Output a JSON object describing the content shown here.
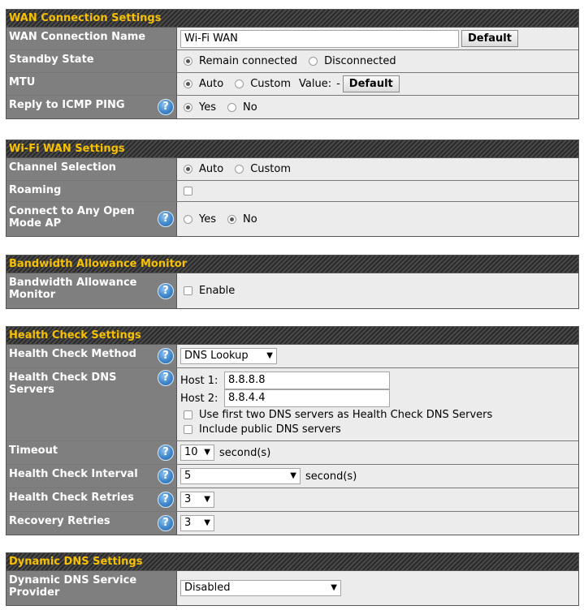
{
  "wan": {
    "title": "WAN Connection Settings",
    "name_label": "WAN Connection Name",
    "name_value": "Wi-Fi WAN",
    "default_btn": "Default",
    "standby_label": "Standby State",
    "standby_opt1": "Remain connected",
    "standby_opt2": "Disconnected",
    "mtu_label": "MTU",
    "mtu_opt1": "Auto",
    "mtu_opt2": "Custom",
    "mtu_value_label": "Value:",
    "mtu_value": "-",
    "mtu_default_btn": "Default",
    "icmp_label": "Reply to ICMP PING",
    "icmp_yes": "Yes",
    "icmp_no": "No"
  },
  "wifi": {
    "title": "Wi-Fi WAN Settings",
    "channel_label": "Channel Selection",
    "channel_opt1": "Auto",
    "channel_opt2": "Custom",
    "roaming_label": "Roaming",
    "open_label": "Connect to Any Open Mode AP",
    "open_yes": "Yes",
    "open_no": "No"
  },
  "bandwidth": {
    "title": "Bandwidth Allowance Monitor",
    "label": "Bandwidth Allowance Monitor",
    "enable": "Enable"
  },
  "health": {
    "title": "Health Check Settings",
    "method_label": "Health Check Method",
    "method_value": "DNS Lookup",
    "dns_label": "Health Check DNS Servers",
    "host1_label": "Host 1:",
    "host1_value": "8.8.8.8",
    "host2_label": "Host 2:",
    "host2_value": "8.8.4.4",
    "use_first": "Use first two DNS servers as Health Check DNS Servers",
    "include_public": "Include public DNS servers",
    "timeout_label": "Timeout",
    "timeout_value": "10",
    "seconds": "second(s)",
    "interval_label": "Health Check Interval",
    "interval_value": "5",
    "retries_label": "Health Check Retries",
    "retries_value": "3",
    "recovery_label": "Recovery Retries",
    "recovery_value": "3"
  },
  "ddns": {
    "title": "Dynamic DNS Settings",
    "provider_label": "Dynamic DNS Service Provider",
    "provider_value": "Disabled"
  },
  "icons": {
    "help": "?",
    "arrow": "▼",
    "help_icon_name": "help-icon",
    "dropdown_icon_name": "chevron-down-icon"
  },
  "colors": {
    "header_text": "#f7c000",
    "label_bg": "#7f7f7f",
    "value_bg": "#ececec",
    "help_blue": "#3f86cc"
  }
}
